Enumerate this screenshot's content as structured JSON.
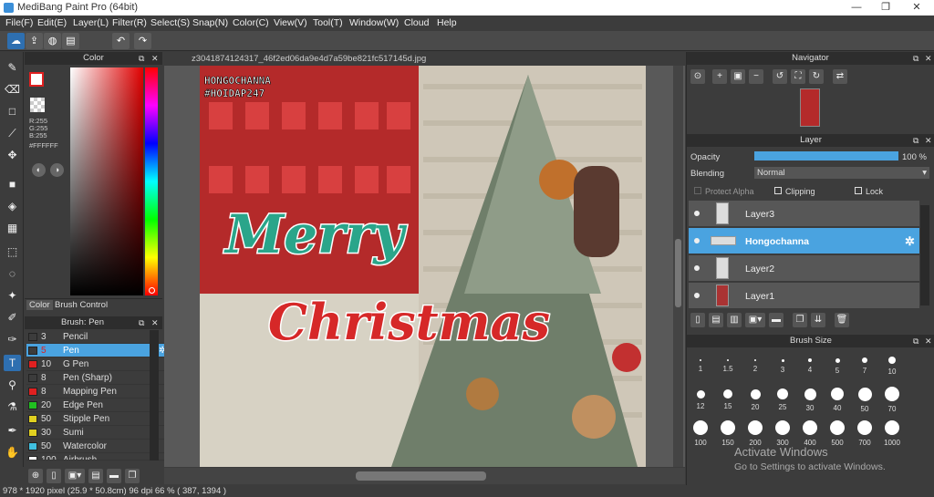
{
  "window": {
    "title": "MediBang Paint Pro (64bit)",
    "minimize": "—",
    "restore": "❐",
    "close": "✕"
  },
  "menu": [
    "File(F)",
    "Edit(E)",
    "Layer(L)",
    "Filter(R)",
    "Select(S)",
    "Snap(N)",
    "Color(C)",
    "View(V)",
    "Tool(T)",
    "Window(W)",
    "Cloud",
    "Help"
  ],
  "color_panel": {
    "title": "Color",
    "rgb_r": "R:255",
    "rgb_g": "G:255",
    "rgb_b": "B:255",
    "hex": "#FFFFFF",
    "tab_color": "Color",
    "tab_brush": "Brush Control"
  },
  "brush_panel": {
    "title": "Brush: Pen",
    "items": [
      {
        "size": "3",
        "name": "Pencil",
        "color": "#3c3c3c"
      },
      {
        "size": "5",
        "name": "Pen",
        "color": "#3c3c3c"
      },
      {
        "size": "10",
        "name": "G Pen",
        "color": "#e02020"
      },
      {
        "size": "8",
        "name": "Pen (Sharp)",
        "color": "#3c3c3c"
      },
      {
        "size": "8",
        "name": "Mapping Pen",
        "color": "#e02020"
      },
      {
        "size": "20",
        "name": "Edge Pen",
        "color": "#20c020"
      },
      {
        "size": "50",
        "name": "Stipple Pen",
        "color": "#e0d020"
      },
      {
        "size": "30",
        "name": "Sumi",
        "color": "#e0d020"
      },
      {
        "size": "50",
        "name": "Watercolor",
        "color": "#40c0e0"
      },
      {
        "size": "100",
        "name": "Airbrush",
        "color": "#ffffff"
      }
    ]
  },
  "document": {
    "filename": "z3041874124317_46f2ed06da9e4d7a59be821fc517145d.jpg",
    "overlay_1": "HONGOCHANNA",
    "overlay_2": "#HOIDAP247",
    "text_merry": "Merry",
    "text_christmas": "Christmas"
  },
  "navigator": {
    "title": "Navigator"
  },
  "layer_panel": {
    "title": "Layer",
    "opacity_label": "Opacity",
    "opacity_value": "100 %",
    "opacity_fraction": 1.0,
    "blending_label": "Blending",
    "blending_value": "Normal",
    "protect_alpha": "Protect Alpha",
    "clipping": "Clipping",
    "lock": "Lock",
    "layers": [
      {
        "name": "Layer3",
        "selected": false
      },
      {
        "name": "Hongochanna",
        "selected": true
      },
      {
        "name": "Layer2",
        "selected": false
      },
      {
        "name": "Layer1",
        "selected": false
      }
    ]
  },
  "brush_size_panel": {
    "title": "Brush Size",
    "sizes": [
      "1",
      "1.5",
      "2",
      "3",
      "4",
      "5",
      "7",
      "10",
      "12",
      "15",
      "20",
      "25",
      "30",
      "40",
      "50",
      "70",
      "100",
      "150",
      "200",
      "300",
      "400",
      "500",
      "700",
      "1000"
    ]
  },
  "watermark": {
    "line1": "Activate Windows",
    "line2": "Go to Settings to activate Windows."
  },
  "status": {
    "text": "978 * 1920 pixel   (25.9 * 50.8cm)   96 dpi   66 %   ( 387, 1394 )"
  }
}
